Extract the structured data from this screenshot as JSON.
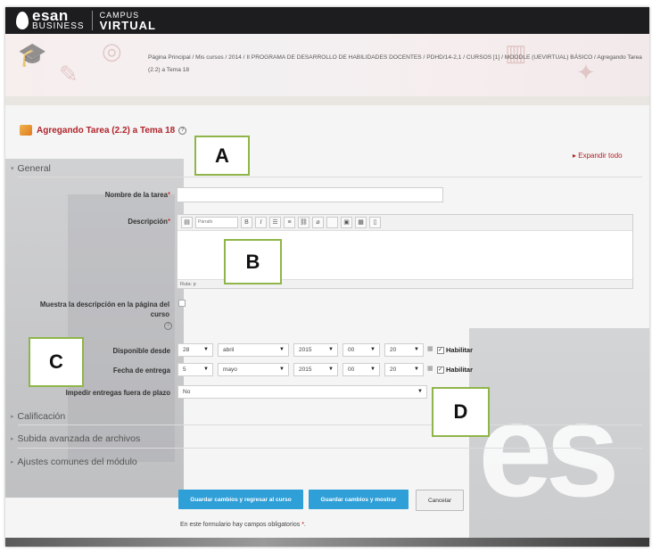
{
  "header": {
    "logo_main": "esan",
    "logo_sub": "BUSINESS",
    "logo_campus": "CAMPUS",
    "logo_virtual": "VIRTUAL"
  },
  "breadcrumb": "Página Principal / Mis cursos / 2014 / II PROGRAMA DE DESARROLLO DE HABILIDADES DOCENTES / PDHD/14-2,1 / CURSOS [1] / MOODLE (UEVIRTUAL) BÁSICO / Agregando Tarea (2.2) a Tema 18",
  "form": {
    "title": "Agregando Tarea (2.2) a Tema 18",
    "expand_all": "Expandir todo",
    "section_general": "General",
    "name_label": "Nombre de la tarea",
    "desc_label": "Descripción",
    "editor_font": "Párrafo",
    "editor_path": "Ruta: p",
    "show_desc_label": "Muestra la descripción en la página del curso",
    "available_label": "Disponible desde",
    "due_label": "Fecha de entrega",
    "prevent_label": "Impedir entregas fuera de plazo",
    "available": {
      "day": "28",
      "month": "abril",
      "year": "2015",
      "hour": "00",
      "minute": "20",
      "enable": "Habilitar"
    },
    "due": {
      "day": "5",
      "month": "mayo",
      "year": "2015",
      "hour": "00",
      "minute": "20",
      "enable": "Habilitar"
    },
    "prevent_value": "No",
    "section_grade": "Calificación",
    "section_upload": "Subida avanzada de archivos",
    "section_common": "Ajustes comunes del módulo",
    "btn_save_return": "Guardar cambios y regresar al curso",
    "btn_save_show": "Guardar cambios y mostrar",
    "btn_cancel": "Cancelar",
    "required_note": "En este formulario hay campos obligatorios"
  },
  "annotations": {
    "a": "A",
    "b": "B",
    "c": "C",
    "d": "D"
  },
  "colors": {
    "accent_red": "#b0232a",
    "button_blue": "#2f9fd8",
    "annotation_green": "#8fb54a"
  }
}
